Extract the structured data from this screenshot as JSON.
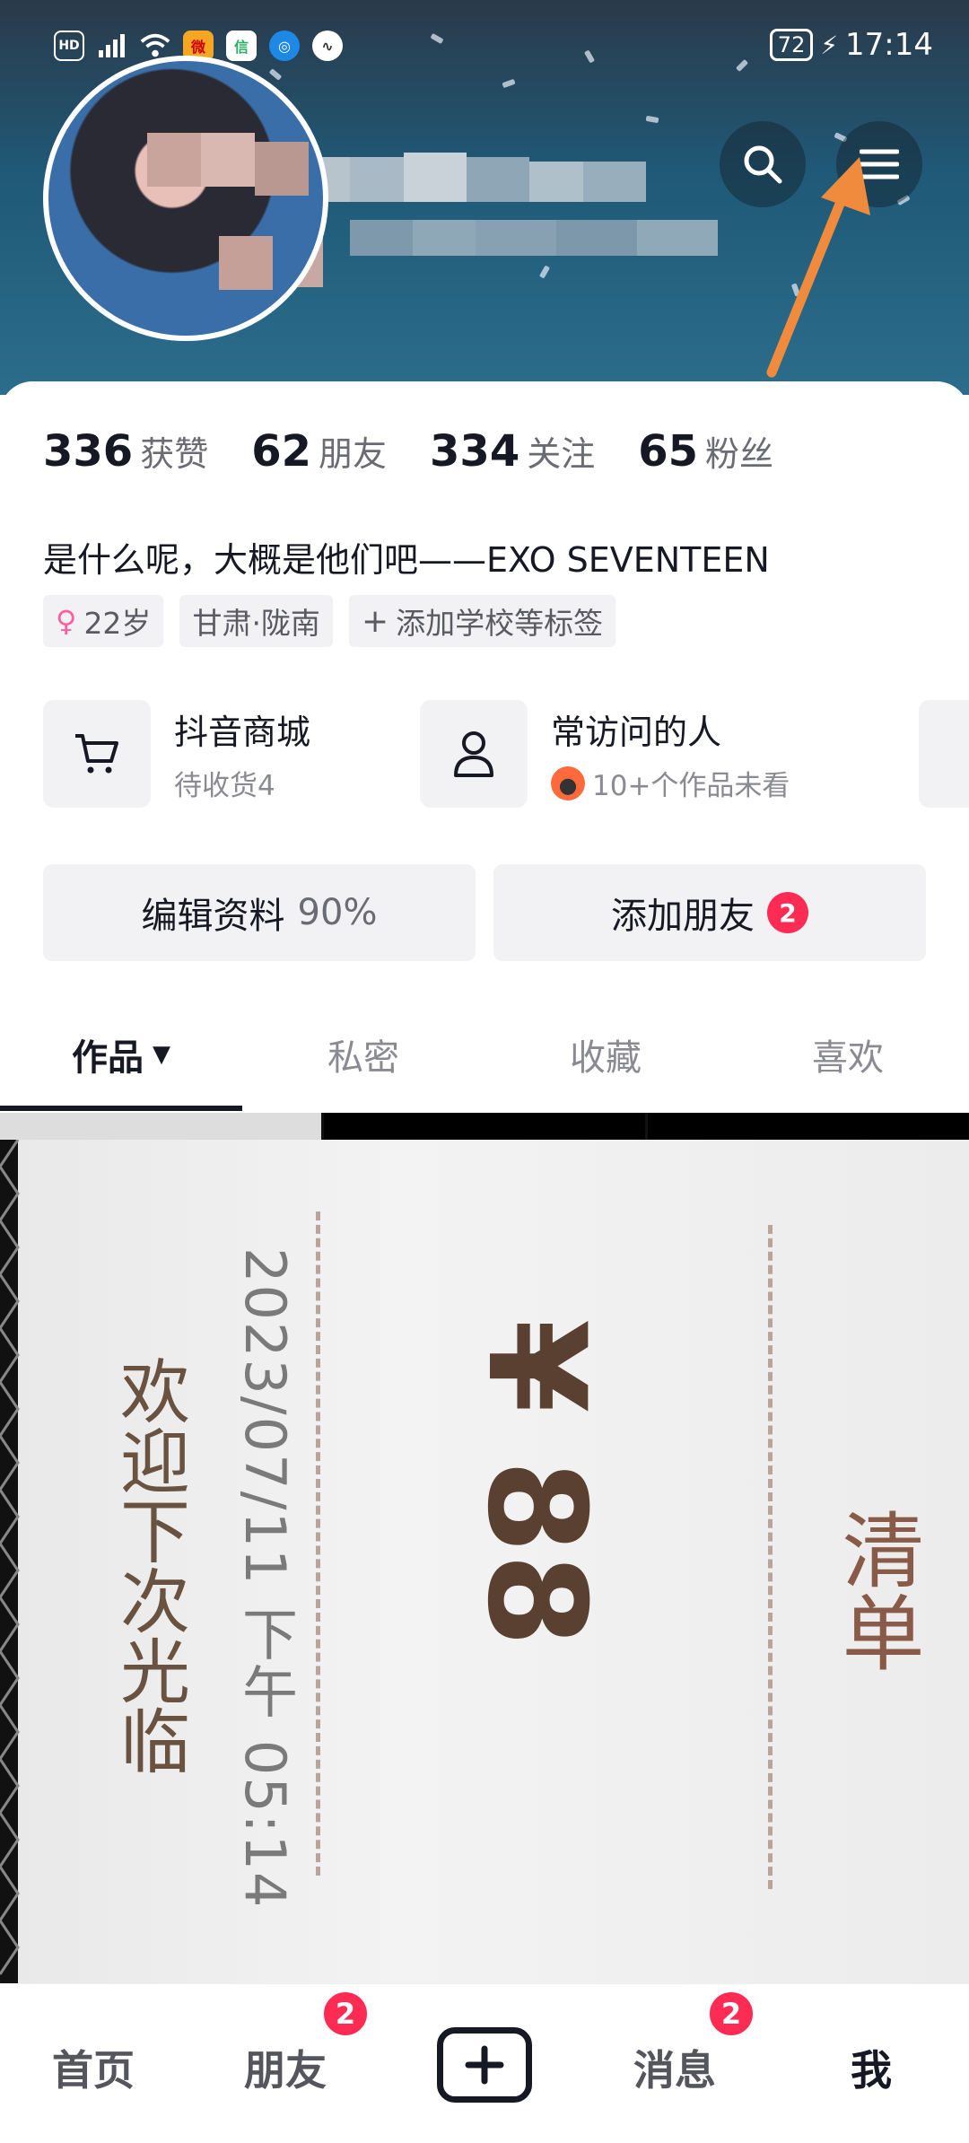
{
  "status_bar": {
    "time": "17:14",
    "battery": "72",
    "left_icons": [
      "HD",
      "5G",
      "signal-icon",
      "wifi-icon",
      "weibo-icon",
      "wechat-icon",
      "browser-icon",
      "voice-icon"
    ]
  },
  "header": {
    "search_icon": "search-icon",
    "menu_icon": "menu-icon"
  },
  "stats": [
    {
      "value": "336",
      "label": "获赞"
    },
    {
      "value": "62",
      "label": "朋友"
    },
    {
      "value": "334",
      "label": "关注"
    },
    {
      "value": "65",
      "label": "粉丝"
    }
  ],
  "bio": "是什么呢，大概是他们吧——EXO  SEVENTEEN",
  "tags": {
    "age": "22岁",
    "location": "甘肃·陇南",
    "add_school": "添加学校等标签"
  },
  "services": [
    {
      "title": "抖音商城",
      "subtitle": "待收货4"
    },
    {
      "title": "常访问的人",
      "subtitle": "10+个作品未看"
    }
  ],
  "actions": {
    "edit_profile": "编辑资料",
    "edit_progress": "90%",
    "add_friends": "添加朋友",
    "add_friends_badge": "2"
  },
  "tabs": [
    {
      "label": "作品"
    },
    {
      "label": "私密"
    },
    {
      "label": "收藏"
    },
    {
      "label": "喜欢"
    }
  ],
  "receipt": {
    "welcome": "欢迎下次光临",
    "datetime": "2023/07/11 下午 05:14",
    "amount": "¥ 88",
    "title": "清单"
  },
  "bottom_nav": {
    "home": "首页",
    "friends": "朋友",
    "friends_badge": "2",
    "messages": "消息",
    "messages_badge": "2",
    "me": "我"
  },
  "colors": {
    "accent": "#fe2c55",
    "arrow": "#f08a3c",
    "header_bg": "#1f5a78"
  }
}
